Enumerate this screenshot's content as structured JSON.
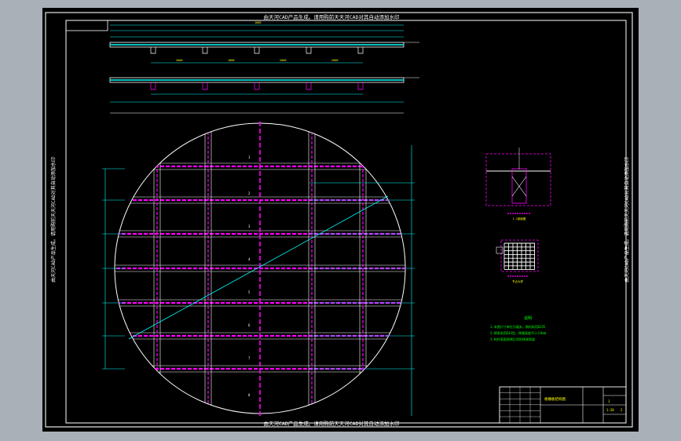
{
  "app": {
    "viewport_background": "#000000",
    "outer_background": "#a9b0b8"
  },
  "drawing": {
    "colors": {
      "frame": "#ffffff",
      "frame_outer": "#e6e6e6",
      "beam": "#ffffff",
      "dimension": "#00ffff",
      "grid_main": "#ff00ff",
      "grid_sub": "#ffffff",
      "label": "#ffff00",
      "green": "#00ff00"
    },
    "top_title": "由天河CAD产品生成。请用购前天天河CAD对其自动添加水印",
    "bottom_title": "由天河CAD产品生成。请用购前天天河CAD对其自动添加水印",
    "left_side_text": "由天河CAD产品生成。请用购前天天河CAD对其自动添加水印",
    "right_side_text": "由天河CAD产品生成。请用购前天天河CAD对其自动添加水印",
    "elevation_dims": [
      "2000",
      "1000",
      "2000",
      "2000",
      "1000"
    ],
    "grid_row_labels": [
      "1",
      "2",
      "3",
      "4",
      "5",
      "6",
      "7",
      "8"
    ],
    "notes_title": "说明",
    "notes_lines": [
      "1.本图尺寸单位为毫米，钢材采用Q235",
      "2.焊条采用E43型，焊缝高度不小于6mm",
      "3.构件表面除锈后涂防锈漆两道"
    ],
    "section_caption": "1-1剖面图",
    "detail_caption": "节点大样",
    "title_block": {
      "drawing_name": "格栅板结构图",
      "sheet": "1",
      "scale": "1:20",
      "page": "2"
    }
  }
}
